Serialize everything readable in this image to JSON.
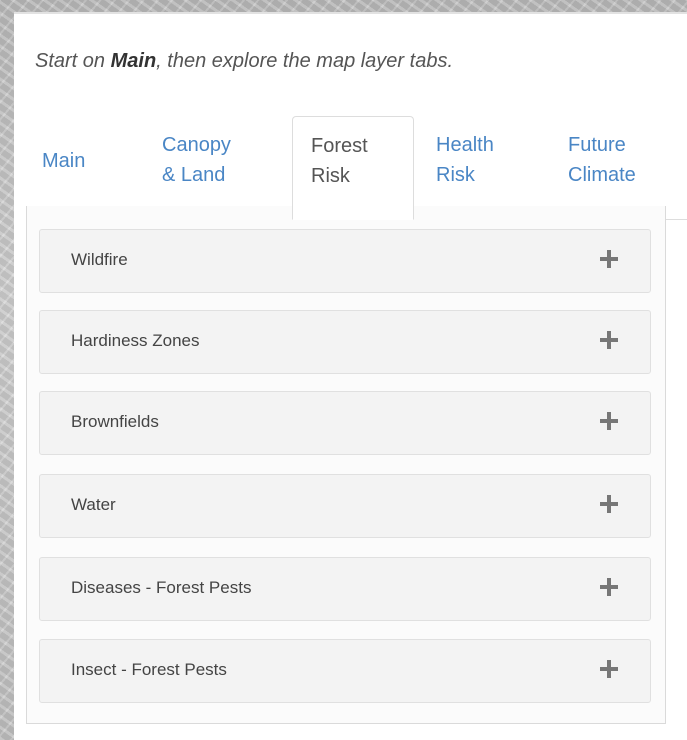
{
  "intro": {
    "prefix": "Start on ",
    "bold": "Main",
    "suffix": ", then explore the map layer tabs."
  },
  "tabs": [
    {
      "line1": "Main",
      "line2": "",
      "active": false
    },
    {
      "line1": "Canopy",
      "line2": "& Land",
      "active": false
    },
    {
      "line1": "Forest",
      "line2": "Risk",
      "active": true
    },
    {
      "line1": "Health",
      "line2": "Risk",
      "active": false
    },
    {
      "line1": "Future",
      "line2": "Climate",
      "active": false
    }
  ],
  "accordion": [
    {
      "label": "Wildfire",
      "icon": "plus-icon"
    },
    {
      "label": "Hardiness Zones",
      "icon": "plus-icon"
    },
    {
      "label": "Brownfields",
      "icon": "plus-icon"
    },
    {
      "label": "Water",
      "icon": "plus-icon"
    },
    {
      "label": "Diseases - Forest Pests",
      "icon": "plus-icon"
    },
    {
      "label": "Insect - Forest Pests",
      "icon": "plus-icon"
    }
  ],
  "colors": {
    "link": "#4a86c5",
    "active_tab_text": "#555555",
    "panel_bg": "#ffffff",
    "accordion_bg": "#f3f3f3"
  }
}
